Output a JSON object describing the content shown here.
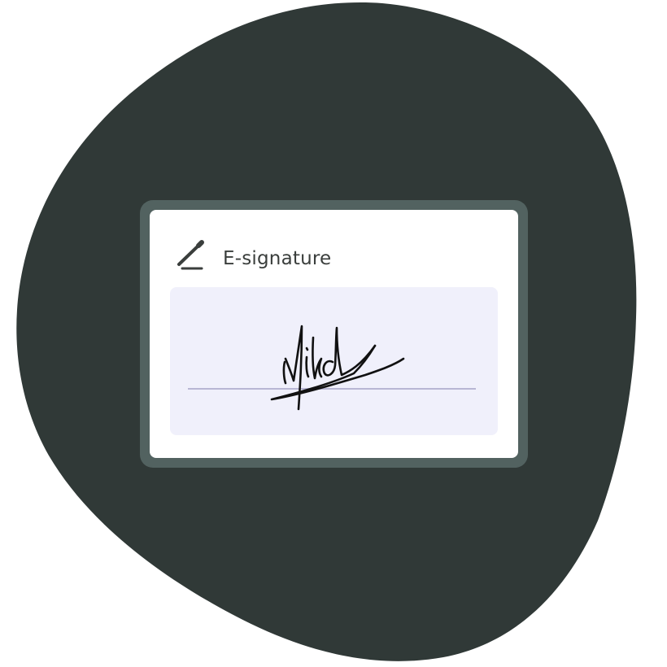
{
  "colors": {
    "blob": "#303937",
    "frame": "#526260",
    "card": "#ffffff",
    "sign_area": "#f0f0fb",
    "sign_line": "#b8b6d4",
    "ink": "#111111",
    "title_text": "#3a3e3c"
  },
  "card": {
    "title": "E-signature",
    "icon": "pen-icon"
  }
}
